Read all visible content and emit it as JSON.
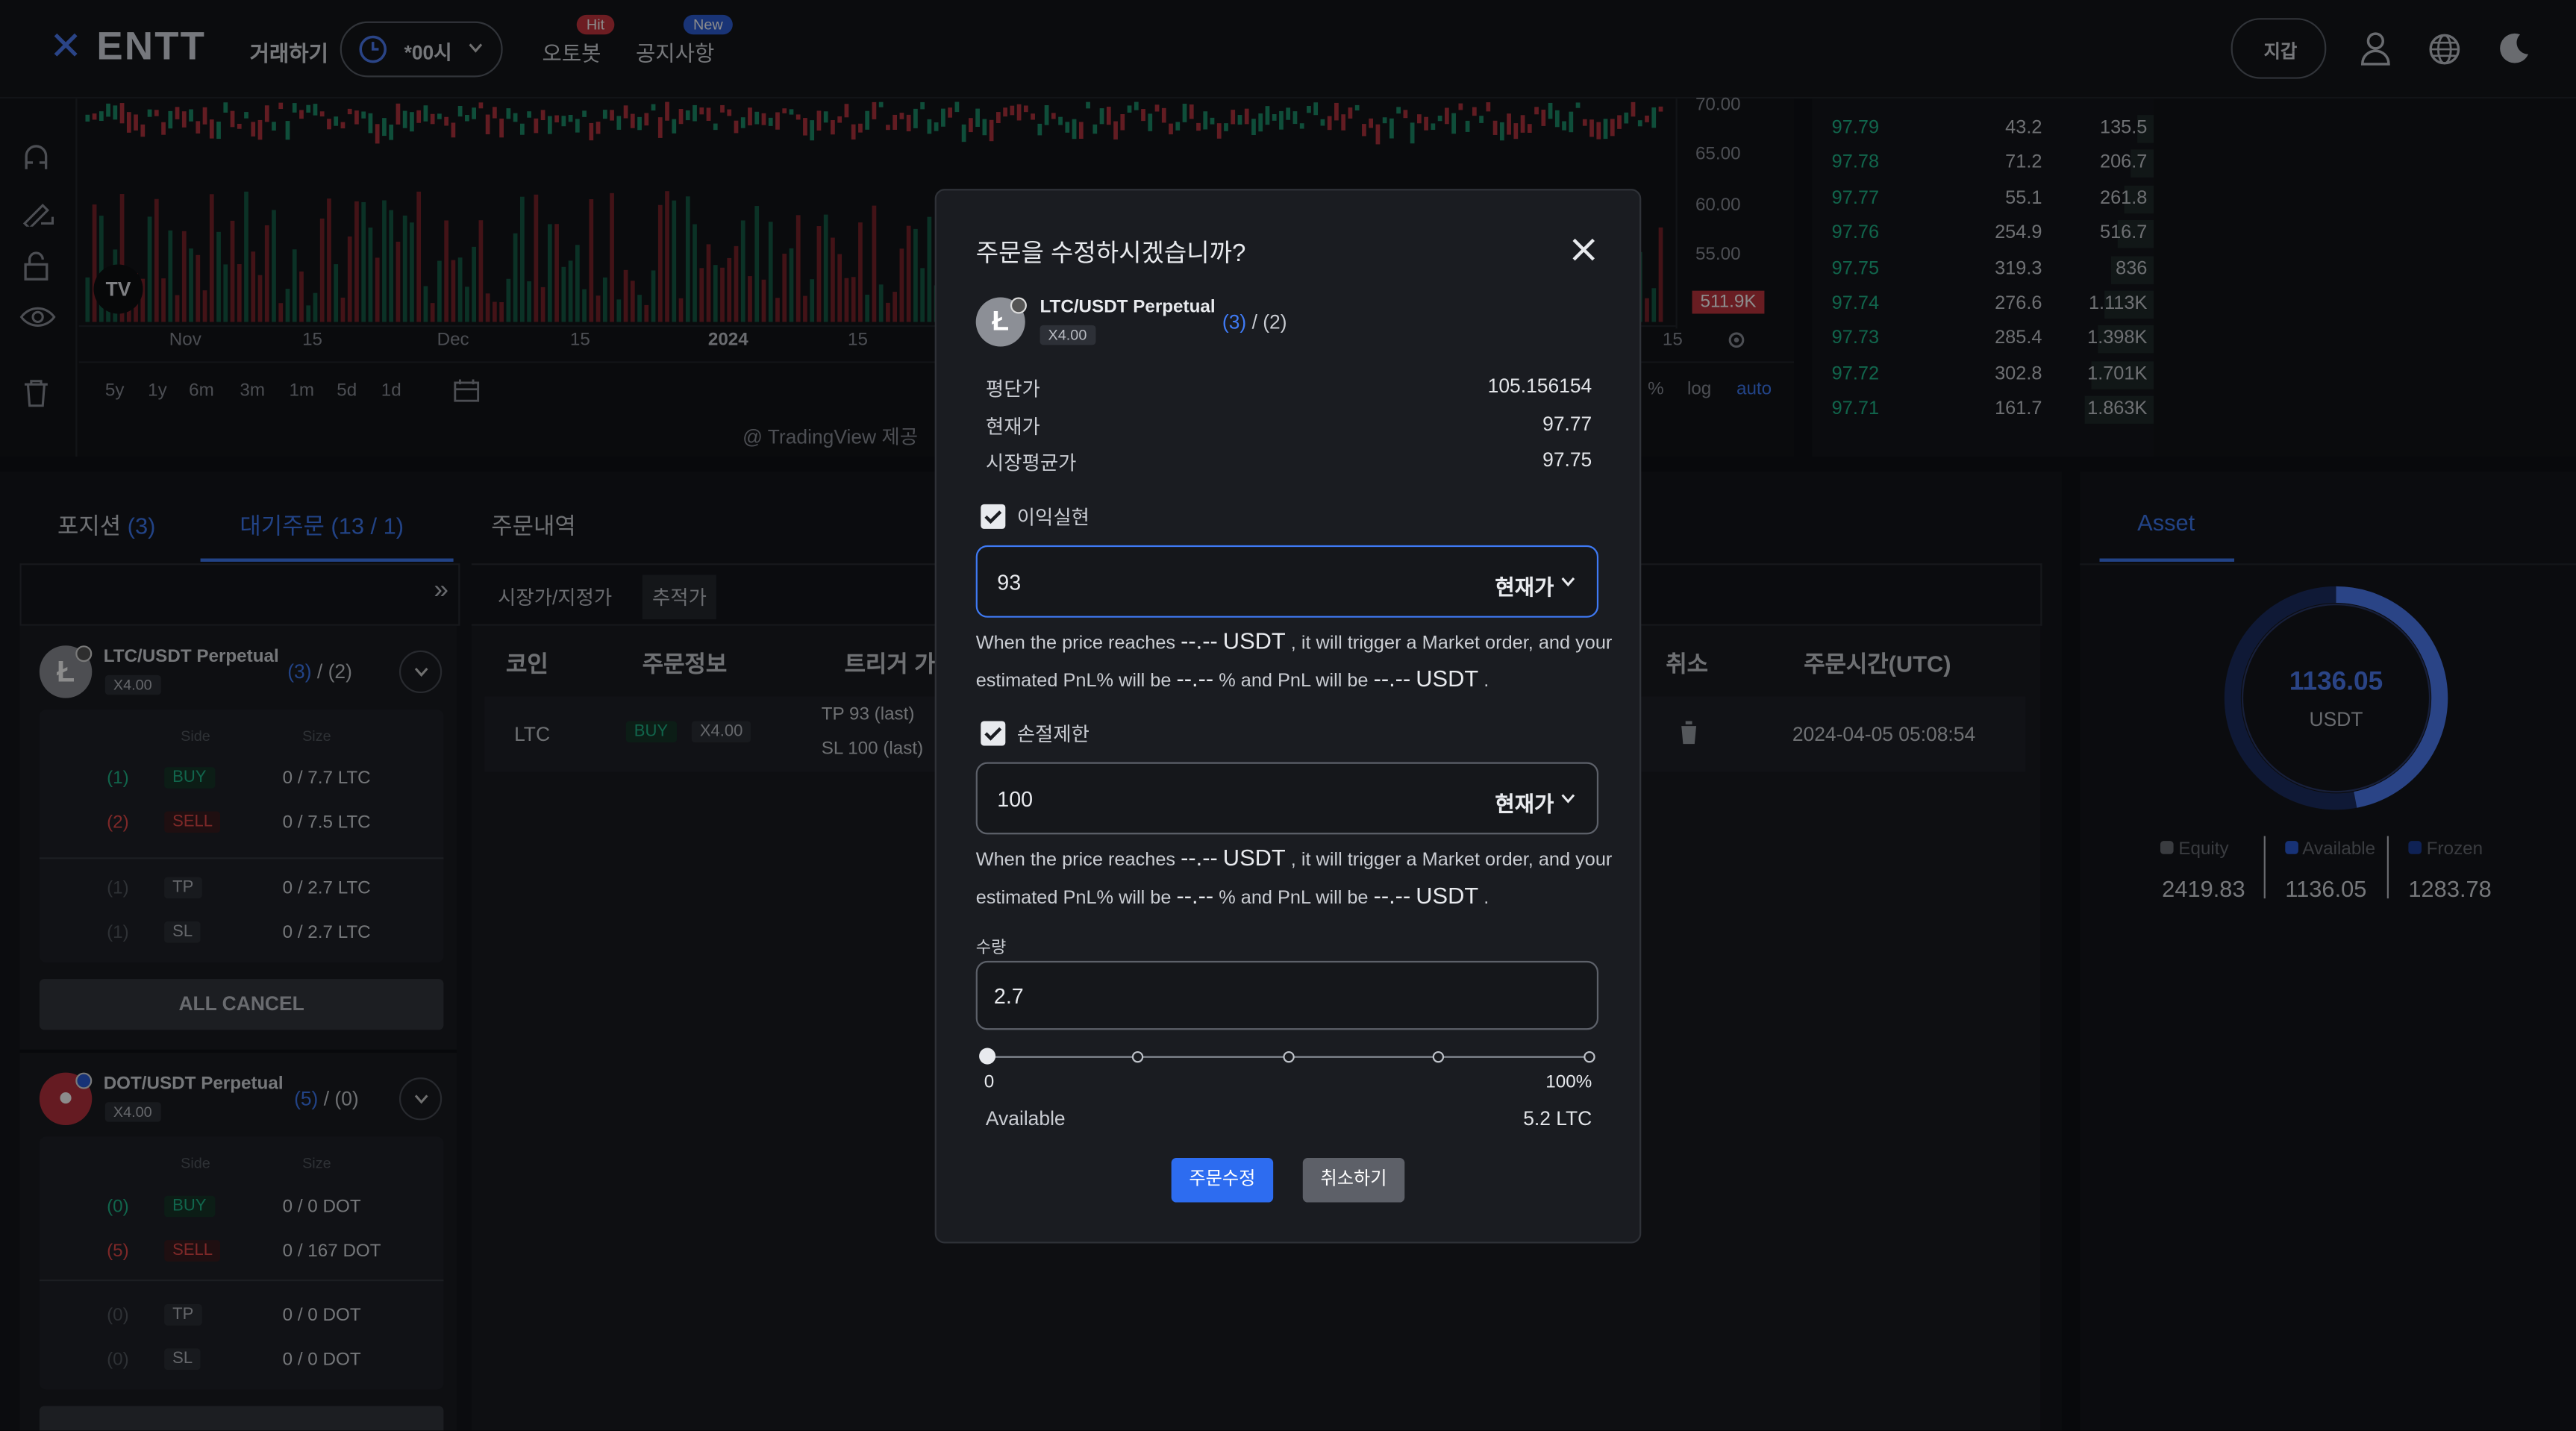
{
  "header": {
    "logo": "ENTT",
    "trade": "거래하기",
    "time_select": "*00시",
    "autobot": "오토봇",
    "autobot_badge": "Hit",
    "notice": "공지사항",
    "notice_badge": "New",
    "wallet_button": "지갑"
  },
  "chart": {
    "price_axis": [
      "70.00",
      "65.00",
      "60.00",
      "55.00"
    ],
    "volume_label": "511.9K",
    "time_axis": [
      "Nov",
      "15",
      "Dec",
      "15",
      "2024",
      "15",
      "15"
    ],
    "ranges": [
      "5y",
      "1y",
      "6m",
      "3m",
      "1m",
      "5d",
      "1d"
    ],
    "scale_opts": [
      "%",
      "log",
      "auto"
    ],
    "attribution": "@ TradingView 제공"
  },
  "orderbook": [
    {
      "price": "97.79",
      "amount": "43.2",
      "total": "135.5"
    },
    {
      "price": "97.78",
      "amount": "71.2",
      "total": "206.7"
    },
    {
      "price": "97.77",
      "amount": "55.1",
      "total": "261.8"
    },
    {
      "price": "97.76",
      "amount": "254.9",
      "total": "516.7"
    },
    {
      "price": "97.75",
      "amount": "319.3",
      "total": "836"
    },
    {
      "price": "97.74",
      "amount": "276.6",
      "total": "1.113K"
    },
    {
      "price": "97.73",
      "amount": "285.4",
      "total": "1.398K"
    },
    {
      "price": "97.72",
      "amount": "302.8",
      "total": "1.701K"
    },
    {
      "price": "97.71",
      "amount": "161.7",
      "total": "1.863K"
    }
  ],
  "tabs": {
    "positions": "포지션",
    "positions_count": "(3)",
    "pending": "대기주문",
    "pending_count": "(13 / 1)",
    "history": "주문내역"
  },
  "subtabs": {
    "market_limit": "시장가/지정가",
    "trailing": "추적가"
  },
  "sidebar": {
    "cards": [
      {
        "pair": "LTC/USDT Perpetual",
        "lev": "X4.00",
        "count_a": "(3)",
        "count_b": "/ (2)",
        "col_side": "Side",
        "col_size": "Size",
        "rows": [
          {
            "n": "(1)",
            "tag": "BUY",
            "size": "0 / 7.7 LTC"
          },
          {
            "n": "(2)",
            "tag": "SELL",
            "size": "0 / 7.5 LTC"
          },
          {
            "n": "(1)",
            "tag": "TP",
            "size": "0 / 2.7 LTC"
          },
          {
            "n": "(1)",
            "tag": "SL",
            "size": "0 / 2.7 LTC"
          }
        ],
        "cancel": "ALL CANCEL"
      },
      {
        "pair": "DOT/USDT Perpetual",
        "lev": "X4.00",
        "count_a": "(5)",
        "count_b": "/ (0)",
        "col_side": "Side",
        "col_size": "Size",
        "rows": [
          {
            "n": "(0)",
            "tag": "BUY",
            "size": "0 / 0 DOT"
          },
          {
            "n": "(5)",
            "tag": "SELL",
            "size": "0 / 167 DOT"
          },
          {
            "n": "(0)",
            "tag": "TP",
            "size": "0 / 0 DOT"
          },
          {
            "n": "(0)",
            "tag": "SL",
            "size": "0 / 0 DOT"
          }
        ]
      }
    ]
  },
  "table": {
    "headers": {
      "coin": "코인",
      "info": "주문정보",
      "trigger": "트리거 가",
      "cancel": "취소",
      "time": "주문시간(UTC)"
    },
    "row": {
      "coin": "LTC",
      "side": "BUY",
      "lev": "X4.00",
      "tp": "TP  93 (last)",
      "sl": "SL  100 (last)",
      "time": "2024-04-05 05:08:54"
    }
  },
  "asset": {
    "tab": "Asset",
    "total": "1136.05",
    "unit": "USDT",
    "equity_label": "Equity",
    "equity": "2419.83",
    "available_label": "Available",
    "available": "1136.05",
    "frozen_label": "Frozen",
    "frozen": "1283.78",
    "available_ratio": 0.47
  },
  "modal": {
    "title": "주문을 수정하시겠습니까?",
    "pair": "LTC/USDT Perpetual",
    "lev": "X4.00",
    "count_a": "(3)",
    "count_b": "/ (2)",
    "avg_label": "평단가",
    "avg": "105.156154",
    "cur_label": "현재가",
    "cur": "97.77",
    "mark_label": "시장평균가",
    "mark": "97.75",
    "tp_label": "이익실현",
    "tp_value": "93",
    "tp_type": "현재가",
    "tp_note": {
      "pre": "When the price reaches",
      "price": "--.--",
      "unit1": "USDT",
      "mid": ", it will trigger a Market order, and your",
      "pre2": "estimated PnL% will be",
      "pct": "--.--",
      "and": "% and PnL will be",
      "pnl": "--.--",
      "unit2": "USDT",
      "end": "."
    },
    "sl_label": "손절제한",
    "sl_value": "100",
    "sl_type": "현재가",
    "sl_note": {
      "pre": "When the price reaches",
      "price": "--.--",
      "unit1": "USDT",
      "mid": ", it will trigger a Market order, and your",
      "pre2": "estimated PnL% will be",
      "pct": "--.--",
      "and": "% and PnL will be",
      "pnl": "--.--",
      "unit2": "USDT",
      "end": "."
    },
    "qty_label": "수량",
    "qty_value": "2.7",
    "slider_min": "0",
    "slider_max": "100%",
    "slider_value": 0,
    "avail_label": "Available",
    "avail_value": "5.2 LTC",
    "confirm": "주문수정",
    "cancel": "취소하기"
  },
  "colors": {
    "accent": "#3f7af5",
    "buy": "#1fb98a",
    "sell": "#e64a4a",
    "volume_tag": "#c0363f"
  }
}
